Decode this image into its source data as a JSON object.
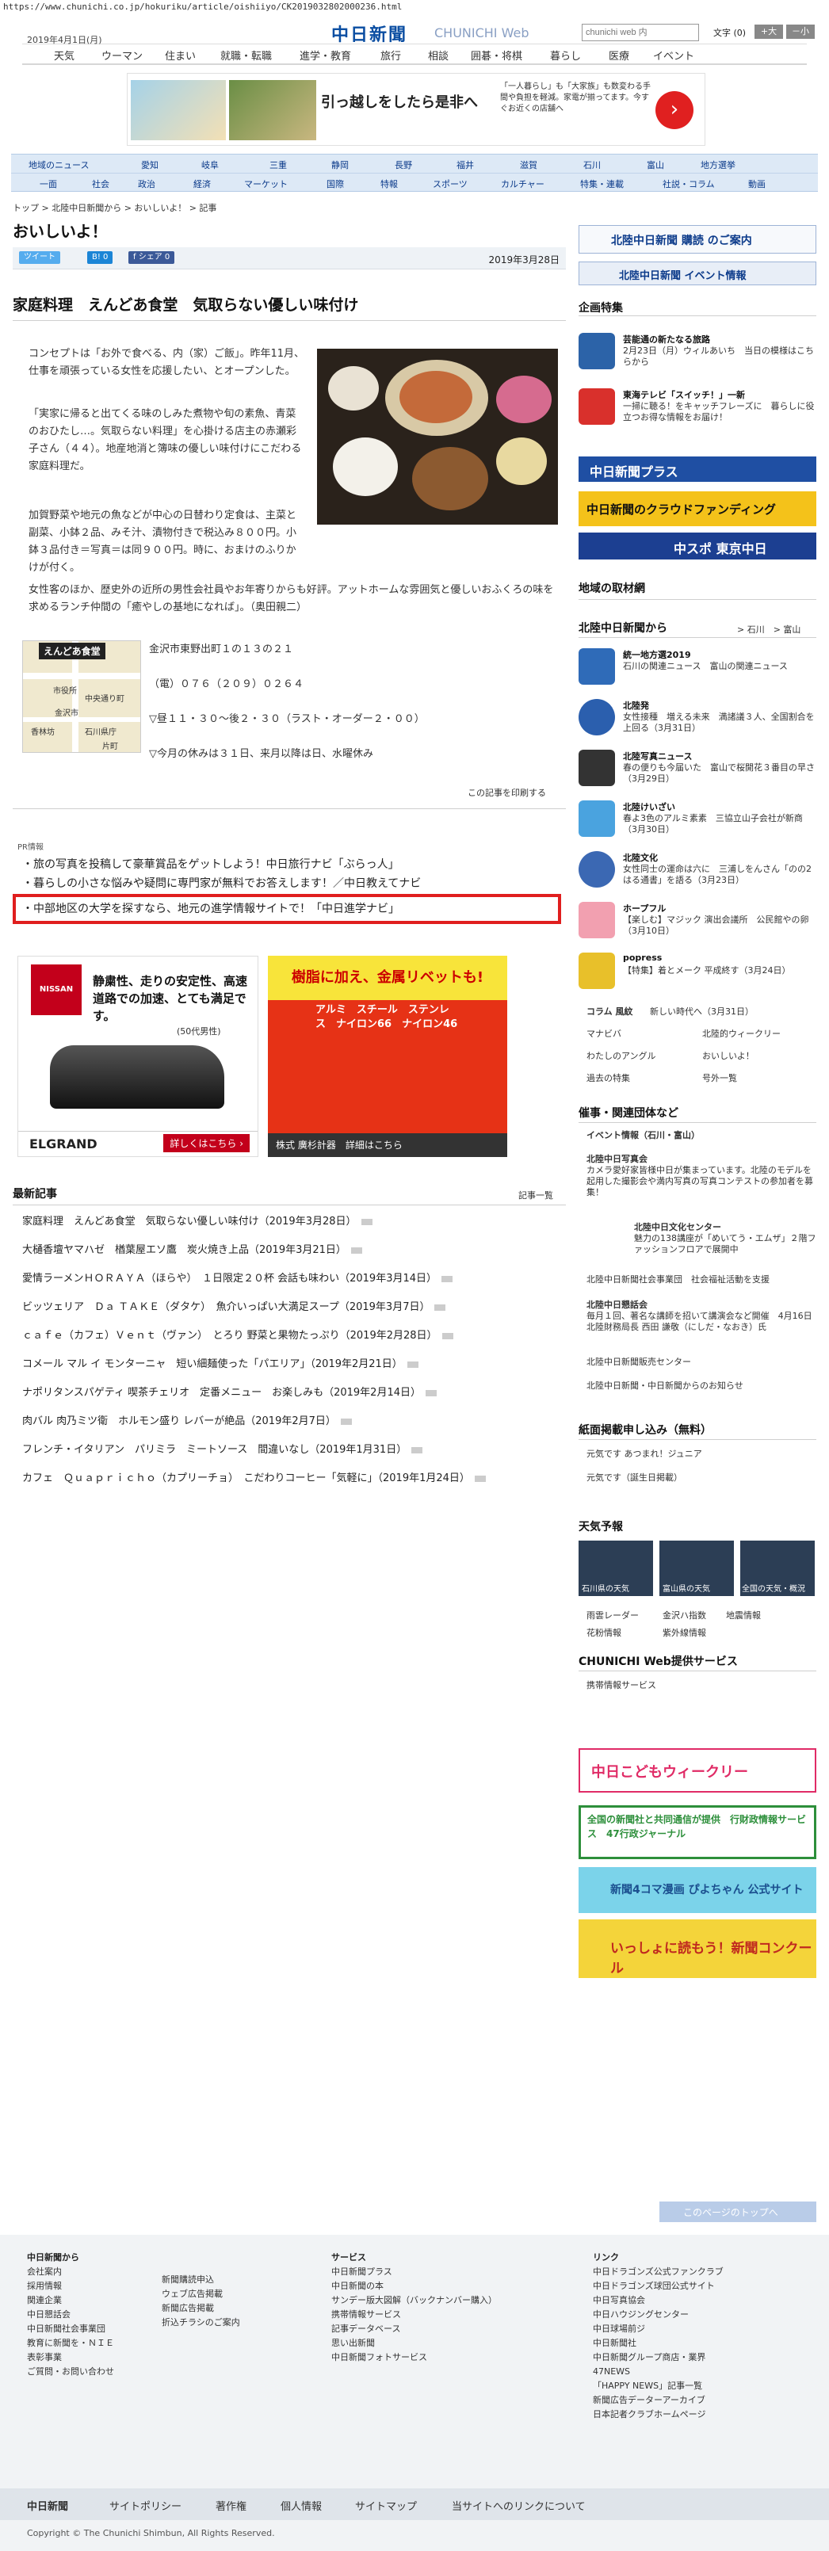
{
  "url": "https://www.chunichi.co.jp/hokuriku/article/oishiiyo/CK2019032802000236.html",
  "header": {
    "date": "2019年4月1日(月)",
    "logo": "中日新聞",
    "logo_sub": "CHUNICHI Web",
    "search_placeholder": "chunichi web 内",
    "font_label": "文字 (0)",
    "font_big": "+大",
    "font_small": "－小"
  },
  "topnav": [
    "天気",
    "ウーマン",
    "住まい",
    "就職・転職",
    "進学・教育",
    "旅行",
    "相談",
    "囲碁・将棋",
    "暮らし",
    "医療",
    "イベント"
  ],
  "ad": {
    "title": "引っ越しをしたら是非へ",
    "desc": "「一人暮らし」も「大家族」も数変わる手間や負担を軽減。家電が揃ってます。今すぐお近くの店舗へ",
    "arrow": "›"
  },
  "subnav_row1": [
    "地域のニュース",
    "愛知",
    "岐阜",
    "三重",
    "静岡",
    "長野",
    "福井",
    "滋賀",
    "石川",
    "富山",
    "地方選挙"
  ],
  "subnav_row2": [
    "一面",
    "社会",
    "政治",
    "経済",
    "マーケット",
    "国際",
    "特報",
    "スポーツ",
    "カルチャー",
    "特集・連載",
    "社説・コラム",
    "動画"
  ],
  "breadcrumb": "トップ > 北陸中日新聞から > おいしいよ！ > 記事",
  "page_title": "おいしいよ！",
  "share": {
    "tweet": "ツイート",
    "hatena": "B! 0",
    "facebook": "f シェア 0",
    "date": "2019年3月28日"
  },
  "article": {
    "headline": "家庭料理　えんどあ食堂　気取らない優しい味付け",
    "p1": "コンセプトは「お外で食べる、内（家）ご飯」。昨年11月、仕事を頑張っている女性を応援したい、とオープンした。",
    "p2": "「実家に帰ると出てくる味のしみた煮物や旬の素魚、青菜のおひたし…。気取らない料理」を心掛ける店主の赤瀬彩子さん（４４）。地産地消と簿味の優しい味付けにこだわる家庭料理だ。",
    "p3": "加賀野菜や地元の魚などが中心の日替わり定食は、主菜と副菜、小鉢２品、みそ汁、漬物付きで税込み８００円。小鉢３品付き＝写真＝は同９００円。時に、おまけのふりかけが付く。",
    "p4": "女性客のほか、歴史外の近所の男性会社員やお年寄りからも好評。アットホームな雰囲気と優しいおふくろの味を求めるランチ仲間の「癒やしの基地になれば」。（奥田親二）",
    "map_label": "えんどあ食堂",
    "map_labels": [
      "市役所",
      "香林坊",
      "石川県庁",
      "中央通り町",
      "金沢市",
      "片町"
    ],
    "address": "金沢市東野出町１の１３の２１",
    "tel": "（電）０７６（２０９）０２６４",
    "hours": "▽昼１１・３０～後２・３０（ラスト・オーダー２・００）",
    "holiday": "▽今月の休みは３１日、来月以降は日、水曜休み",
    "print": "この記事を印刷する"
  },
  "pr": {
    "label": "PR情報",
    "items": [
      "・旅の写真を投稿して豪華賞品をゲットしよう！中日旅行ナビ「ぶらっ人」",
      "・暮らしの小さな悩みや疑問に専門家が無料でお答えします！／中日教えてナビ",
      "・中部地区の大学を探すなら、地元の進学情報サイトで！「中日進学ナビ」"
    ]
  },
  "ads": {
    "nissan_logo": "NISSAN",
    "nissan_copy": "静粛性、走りの安定性、高速道路での加速、とても満足です。",
    "nissan_sub": "(50代男性)",
    "nissan_model": "ELGRAND",
    "nissan_btn": "詳しくはこちら ›",
    "rivet_head": "樹脂に加え、金属リベットも!",
    "rivet_mats": "アルミ　スチール　ステンレス　ナイロン66　ナイロン46",
    "rivet_footer": "株式 廣杉計器　詳細はこちら"
  },
  "latest": {
    "title": "最新記事",
    "link": "記事一覧",
    "items": [
      "家庭料理　えんどあ食堂　気取らない優しい味付け（2019年3月28日）",
      "大樋香壇ヤマハゼ　楢葉屋エソ鷹　炭火焼き上品（2019年3月21日）",
      "愛情ラーメンＨＯＲＡＹＡ（ほらや）　１日限定２０杯 会話も味わい（2019年3月14日）",
      "ビッツェリア　Ｄａ ＴＡＫＥ（ダタケ）　魚介いっぱい大満足スープ（2019年3月7日）",
      "ｃａｆｅ（カフェ）Ｖｅｎｔ（ヴァン）　とろり 野菜と果物たっぷり（2019年2月28日）",
      "コメール マル イ モンターニャ　短い細麺使った「パエリア」（2019年2月21日）",
      "ナポリタンスパゲティ 喫茶チェリオ　定番メニュー　お楽しみも（2019年2月14日）",
      "肉バル 肉乃ミツ衛　ホルモン盛り レバーが絶品（2019年2月7日）",
      "フレンチ・イタリアン　パリミラ　ミートソース　間違いなし（2019年1月31日）",
      "カフェ　Ｑｕａｐｒｉｃｈｏ（カプリーチョ）　こだわりコーヒー「気軽に」（2019年1月24日）"
    ]
  },
  "right": {
    "hokuriku_banner": "北陸中日新聞 購読 のご案内",
    "event_banner": "北陸中日新聞 イベント情報",
    "feature_title": "企画特集",
    "feature1_t1": "芸能通の新たなる旅路",
    "feature1_t2": "2月23日（月）ウィルあいち　当日の模様はこちらから",
    "feature2_t1": "東海テレビ「スイッチ！」一新",
    "feature2_t2": "一掃に聴る！をキャッチフレーズに　暮らしに役立つお得な情報をお届け！",
    "plus_banner": "中日新聞プラス",
    "crowd_banner": "中日新聞のクラウドファンディング",
    "chuspo_banner": "中スポ 東京中日",
    "local_title": "地域の取材網",
    "hokuriku_title": "北陸中日新聞から",
    "hokuriku_links": "> 石川　> 富山",
    "items": [
      {
        "t1": "統一地方選2019",
        "t2": "石川の関連ニュース　富山の関連ニュース"
      },
      {
        "t1": "北陸発",
        "t2": "女性接種　増える未来　満諸議３人、全国割合を上回る（3月31日）"
      },
      {
        "t1": "北陸写真ニュース",
        "t2": "春の便りも今届いた　富山で桜開花３番目の早さ（3月29日）"
      },
      {
        "t1": "北陸けいざい",
        "t2": "春よ3色のアルミ素素　三協立山子会社が新商（3月30日）"
      },
      {
        "t1": "北陸文化",
        "t2": "女性同士の運命は六に　三浦しをんさん「のの2はる通書」を語る（3月23日）"
      },
      {
        "t1": "ホープフル",
        "t2": "【楽しむ】マジック 演出会議所　公民館やの卵（3月10日）"
      },
      {
        "t1": "popress",
        "t2": "【特集】着とメーク 平成終す（3月24日）"
      }
    ],
    "colum_label": "コラム 風紋",
    "colum_text": "新しい時代へ（3月31日）",
    "grid_links": [
      "マナビバ",
      "北陸的ウィークリー",
      "わたしのアングル",
      "おいしいよ！",
      "過去の特集",
      "号外一覧"
    ],
    "events_title": "催事・関連団体など",
    "events_sub": "イベント情報（石川・富山）",
    "event1_t1": "北陸中日写真会",
    "event1_t2": "カメラ愛好家皆様中日が集まっています。北陸のモデルを起用した撮影会や満内写真の写真コンテストの参加者を募集！",
    "event2_t1": "北陸中日文化センター",
    "event2_t2": "魅力の138講座が「めいてう・エムザ」２階ファッションフロアで展開中",
    "event3": "北陸中日新聞社会事業団　社会福祉活動を支援",
    "event4_t1": "北陸中日懇話会",
    "event4_t2": "毎月１回、著名な講師を招いて講演会など開催　4月16日 北陸財務局長 西田 謙敬（にしだ・なおき）氏",
    "event5": "北陸中日新聞販売センター",
    "event6": "北陸中日新聞・中日新聞からのお知らせ",
    "ads_title": "紙面掲載申し込み（無料）",
    "ads1": "元気です あつまれ！ジュニア",
    "ads2": "元気です（誕生日掲載）",
    "weather_title": "天気予報",
    "weather": [
      "石川県の天気",
      "富山県の天気",
      "全国の天気・概況"
    ],
    "weather_links": [
      "雨雲レーダー",
      "金沢ハ指数",
      "花粉情報",
      "地震情報",
      "紫外線情報"
    ],
    "service_title": "CHUNICHI Web提供サービス",
    "service_item": "携帯情報サービス",
    "kodomo": "中日こどもウィークリー",
    "gyosei": "全国の新聞社と共同通信が提供　行財政情報サービス　47行政ジャーナル",
    "hanamaru": "新聞4コマ漫画 ぴよちゃん 公式サイト",
    "concours": "いっしょに読もう！新聞コンクール",
    "back_top": "このページのトップへ"
  },
  "footer": {
    "col1_h": "中日新聞から",
    "col1": [
      "会社案内",
      "採用情報",
      "関連企業",
      "中日懇話会",
      "中日新聞社会事業団",
      "教育に新聞を・ＮＩＥ",
      "表彰事業",
      "ご質問・お問い合わせ"
    ],
    "col2": [
      "新聞購読申込",
      "ウェブ広告掲載",
      "新聞広告掲載",
      "折込チラシのご案内"
    ],
    "col3_h": "サービス",
    "col3": [
      "中日新聞プラス",
      "中日新聞の本",
      "サンデー版大図解（バックナンバー購入）",
      "携帯情報サービス",
      "記事データベース",
      "思い出新聞",
      "中日新聞フォトサービス"
    ],
    "col4_h": "リンク",
    "col4": [
      "中日ドラゴンズ公式ファンクラブ",
      "中日ドラゴンズ球団公式サイト",
      "中日写真協会",
      "中日ハウジングセンター",
      "中日球場前ジ",
      "中日新聞社",
      "中日新聞グループ商店・業界",
      "47NEWS",
      "「HAPPY NEWS」記事一覧",
      "新聞広告データーアーカイブ",
      "日本記者クラブホームページ"
    ],
    "bar": [
      "中日新聞",
      "サイトポリシー",
      "著作権",
      "個人情報",
      "サイトマップ",
      "当サイトへのリンクについて"
    ],
    "copyright": "Copyright © The Chunichi Shimbun, All Rights Reserved."
  }
}
